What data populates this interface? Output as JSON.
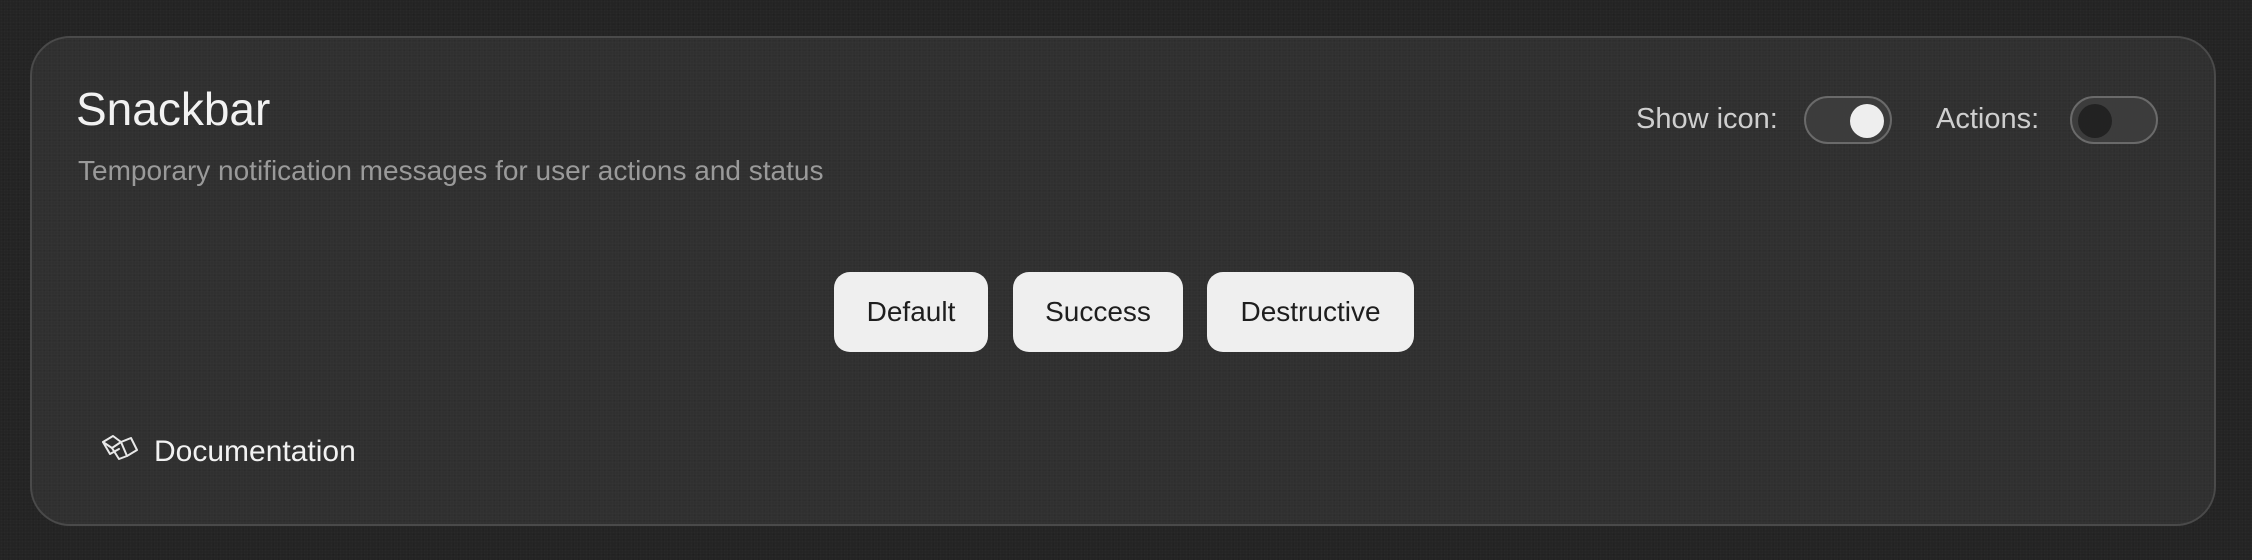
{
  "card": {
    "title": "Snackbar",
    "subtitle": "Temporary notification messages for user actions and status"
  },
  "controls": {
    "show_icon": {
      "label": "Show icon:",
      "state": "on"
    },
    "actions": {
      "label": "Actions:",
      "state": "off"
    }
  },
  "buttons": [
    {
      "label": "Default"
    },
    {
      "label": "Success"
    },
    {
      "label": "Destructive"
    }
  ],
  "footer": {
    "documentation_label": "Documentation",
    "icon": "book-open-icon"
  }
}
